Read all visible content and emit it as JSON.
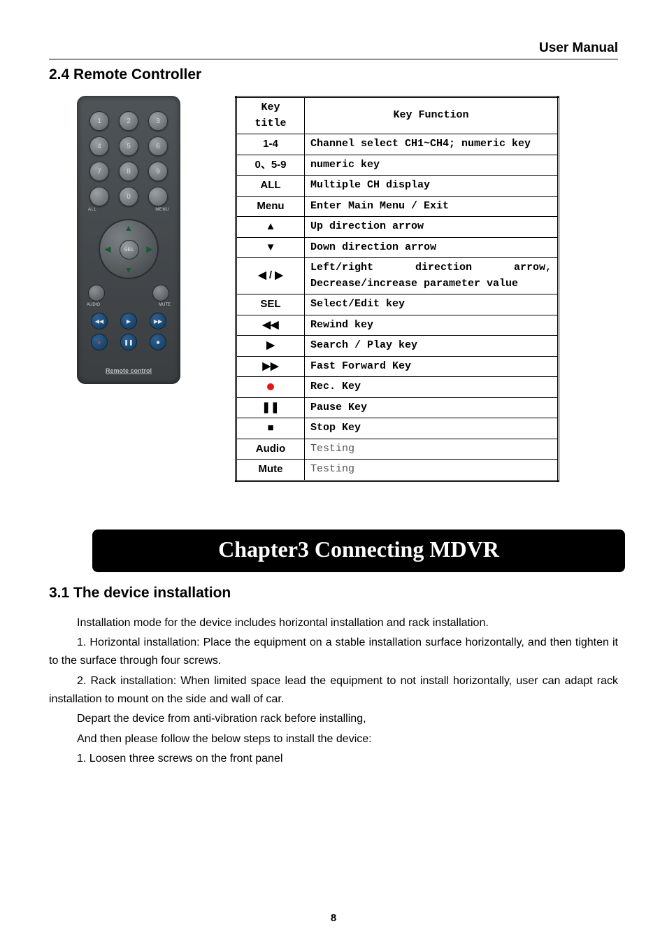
{
  "header": {
    "title": "User Manual"
  },
  "section24": {
    "heading": "2.4 Remote Controller"
  },
  "remote": {
    "sel_label": "SEL",
    "brand": "Remote control",
    "label_all": "ALL",
    "label_menu": "MENU",
    "label_audio": "AUDIO",
    "label_mute": "MUTE"
  },
  "table": {
    "hdr_key": "Key title",
    "hdr_fn": "Key Function",
    "rows": [
      {
        "key": "1-4",
        "fn": "Channel select CH1~CH4; numeric key"
      },
      {
        "key": "0、5-9",
        "fn": "numeric key"
      },
      {
        "key": "ALL",
        "fn": "Multiple CH display"
      },
      {
        "key": "Menu",
        "fn": "Enter Main Menu / Exit"
      },
      {
        "key": "▲",
        "fn": "Up direction arrow"
      },
      {
        "key": "▼",
        "fn": "Down direction arrow"
      },
      {
        "key": "◀ / ▶",
        "fn": "Left/right direction arrow, Decrease/increase parameter value"
      },
      {
        "key": "SEL",
        "fn": "Select/Edit key"
      },
      {
        "key": "◀◀",
        "fn": "Rewind key"
      },
      {
        "key": "▶",
        "fn": "Search / Play key"
      },
      {
        "key": "▶▶",
        "fn": "Fast Forward Key"
      },
      {
        "key": "●",
        "fn": "Rec. Key"
      },
      {
        "key": "❚❚",
        "fn": "Pause Key"
      },
      {
        "key": "■",
        "fn": "Stop Key"
      },
      {
        "key": "Audio",
        "fn": "Testing"
      },
      {
        "key": "Mute",
        "fn": "Testing"
      }
    ]
  },
  "chapter": {
    "title": "Chapter3 Connecting MDVR"
  },
  "section31": {
    "heading": "3.1 The device installation",
    "p1": "Installation mode for the device includes horizontal installation and rack installation.",
    "p2": "1. Horizontal installation: Place the equipment on a stable installation surface horizontally, and then tighten it to the surface through four screws.",
    "p3": "2.  Rack installation: When limited space lead the equipment to not install horizontally, user can adapt rack installation to mount on the side and wall of car.",
    "p4": "Depart the device from anti-vibration rack before installing,",
    "p5": "And then please follow the below steps to install the device:",
    "p6": "1. Loosen three screws on the front panel"
  },
  "page_number": "8"
}
